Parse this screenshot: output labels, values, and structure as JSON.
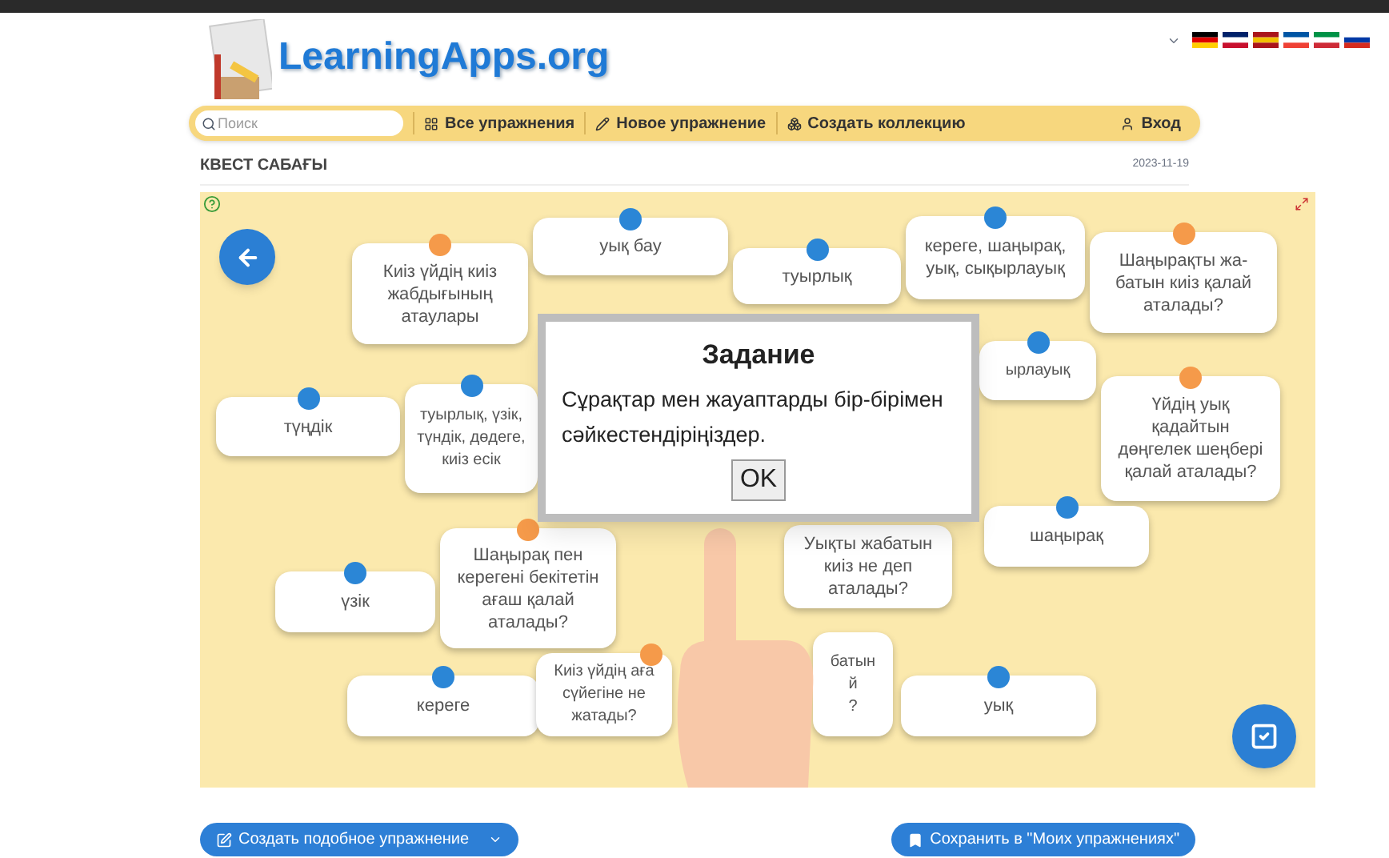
{
  "header": {
    "logo": "LearningApps.org"
  },
  "nav": {
    "search": {
      "placeholder": "Поиск"
    },
    "items": [
      "Все упражнения",
      "Новое упражнение",
      "Создать коллекцию"
    ],
    "login": "Вход"
  },
  "title": "КВЕСТ САБАҒЫ",
  "date": "2023-11-19",
  "game": {
    "cards": [
      {
        "text": "Киіз үйдің киіз\nжабдығының\nатаулары",
        "kind": "question"
      },
      {
        "text": "уық бау",
        "kind": "answer"
      },
      {
        "text": "туырлық",
        "kind": "answer"
      },
      {
        "text": "кереге, шаңырақ,\nуық, сықырлауық",
        "kind": "answer"
      },
      {
        "text": "Шаңырақты жа-\nбатын киіз қалай\nаталады?",
        "kind": "question"
      },
      {
        "text": "ырлауық",
        "kind": "answer"
      },
      {
        "text": "түңдік",
        "kind": "answer"
      },
      {
        "text": "туырлық, үзік,\nтүндік, дөдеге,\nкиіз есік",
        "kind": "answer"
      },
      {
        "text": "Үйдің уық\nқадайтын\nдөңгелек шеңбері\nқалай аталады?",
        "kind": "question"
      },
      {
        "text": "шаңырақ",
        "kind": "answer"
      },
      {
        "text": "Уықты жабатын\nкиіз не деп\nаталады?"
      },
      {
        "text": "үзік",
        "kind": "answer"
      },
      {
        "text": "Шаңырақ пен\nкерегені бекітетін\nағаш қалай\nаталады?",
        "kind": "question"
      },
      {
        "text": "кереге",
        "kind": "answer"
      },
      {
        "text": "Киіз үйдің аға\nсүйегіне не\nжатады?",
        "kind": "question"
      },
      {
        "text": "батын\nй\n?"
      },
      {
        "text": "уық",
        "kind": "answer"
      }
    ],
    "dialog": {
      "title": "Задание",
      "text": "Сұрақтар мен жауаптарды бір-бірімен сәйкестендіріңіздер.",
      "button": "OK"
    }
  },
  "footer": {
    "create": "Создать подобное упражнение",
    "save": "Сохранить в \"Моих упражнениях\""
  }
}
